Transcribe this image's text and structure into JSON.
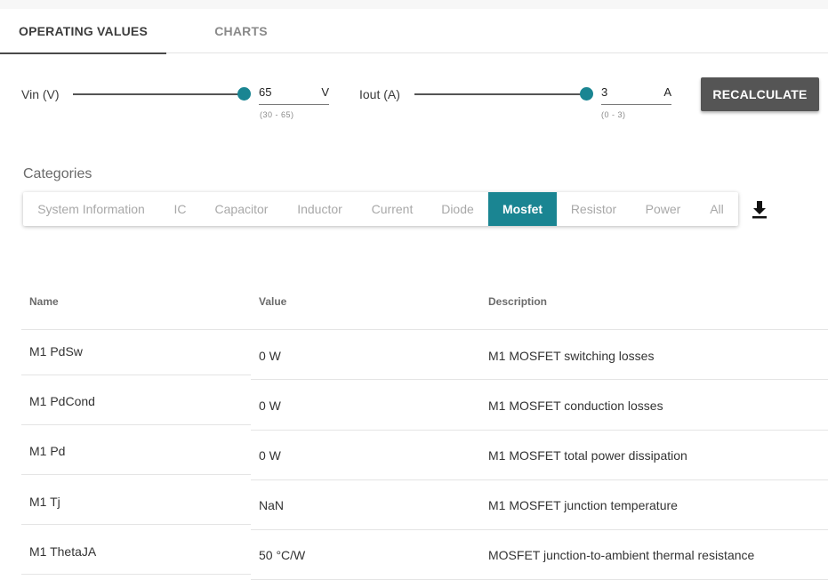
{
  "tabs": [
    {
      "label": "OPERATING VALUES"
    },
    {
      "label": "CHARTS"
    }
  ],
  "vin": {
    "label": "Vin (V)",
    "value": "65",
    "unit": "V",
    "range": "(30 - 65)",
    "level": 1.0
  },
  "iout": {
    "label": "Iout (A)",
    "value": "3",
    "unit": "A",
    "range": "(0 - 3)",
    "level": 1.0
  },
  "recalculate_label": "RECALCULATE",
  "categories": {
    "title": "Categories",
    "items": [
      "System Information",
      "IC",
      "Capacitor",
      "Inductor",
      "Current",
      "Diode",
      "Mosfet",
      "Resistor",
      "Power",
      "All"
    ],
    "selected": "Mosfet"
  },
  "download_icon": "download-icon",
  "table": {
    "headers": [
      "Name",
      "Value",
      "Description"
    ],
    "rows": [
      {
        "name": "M1 PdSw",
        "value": "0 W",
        "description": "M1 MOSFET switching losses"
      },
      {
        "name": "M1 PdCond",
        "value": "0 W",
        "description": "M1 MOSFET conduction losses"
      },
      {
        "name": "M1 Pd",
        "value": "0 W",
        "description": "M1 MOSFET total power dissipation"
      },
      {
        "name": "M1 Tj",
        "value": "NaN",
        "description": "M1 MOSFET junction temperature"
      },
      {
        "name": "M1 ThetaJA",
        "value": "50 °C/W",
        "description": "MOSFET junction-to-ambient thermal resistance"
      }
    ]
  },
  "colors": {
    "accent": "#1a8592",
    "button": "#555555"
  }
}
